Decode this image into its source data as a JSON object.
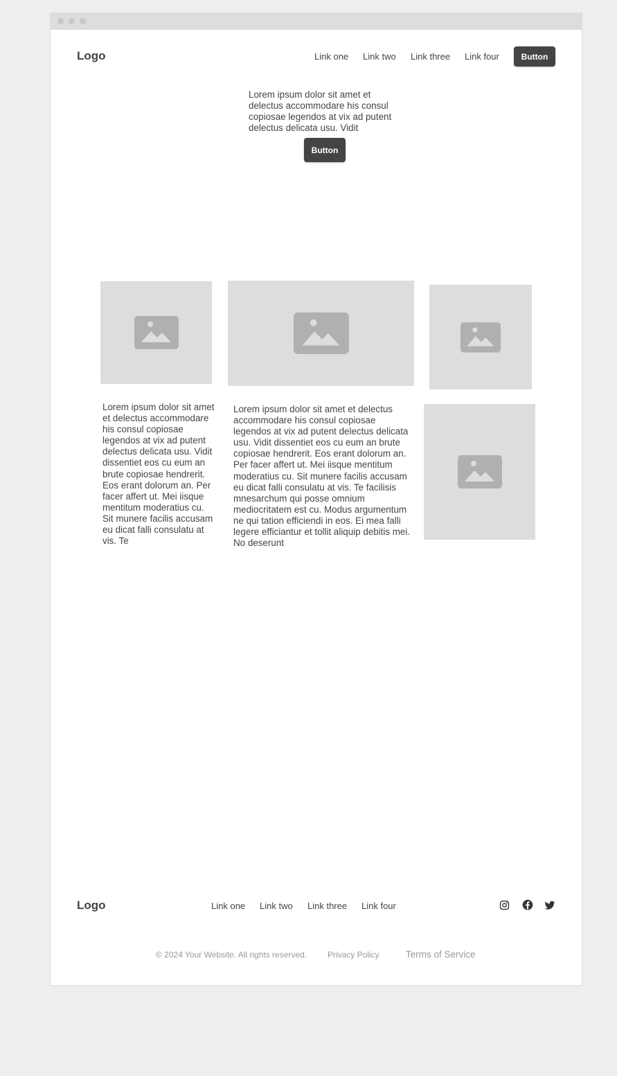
{
  "header": {
    "logo": "Logo",
    "links": [
      "Link one",
      "Link two",
      "Link three",
      "Link four"
    ],
    "button": "Button"
  },
  "hero": {
    "text": "Lorem ipsum dolor sit amet et delectus accommodare his consul copiosae legendos at vix ad putent delectus delicata usu. Vidit",
    "button": "Button"
  },
  "content": {
    "left_text": "Lorem ipsum dolor sit amet et delectus accommodare his consul copiosae legendos at vix ad putent delectus delicata usu. Vidit dissentiet eos cu eum an brute copiosae hendrerit. Eos erant dolorum an. Per facer affert ut. Mei iisque mentitum moderatius cu. Sit munere facilis accusam eu dicat falli consulatu at vis. Te",
    "middle_text": "Lorem ipsum dolor sit amet et delectus accommodare his consul copiosae legendos at vix ad putent delectus delicata usu. Vidit dissentiet eos cu eum an brute copiosae hendrerit. Eos erant dolorum an. Per facer affert ut. Mei iisque mentitum moderatius cu. Sit munere facilis accusam eu dicat falli consulatu at vis. Te facilisis mnesarchum qui posse omnium mediocritatem est cu. Modus argumentum ne qui tation efficiendi in eos. Ei mea falli legere efficiantur et tollit aliquip debitis mei. No deserunt"
  },
  "footer": {
    "logo": "Logo",
    "links": [
      "Link one",
      "Link two",
      "Link three",
      "Link four"
    ],
    "social_icons": [
      "instagram-icon",
      "facebook-icon",
      "twitter-icon"
    ],
    "copyright": "© 2024 Your Website. All rights reserved.",
    "privacy": "Privacy Policy",
    "terms": "Terms of Service"
  },
  "colors": {
    "page_background": "#eeeeee",
    "window_background": "#ffffff",
    "placeholder": "#dddddd",
    "placeholder_icon": "#b0b0b0",
    "button": "#444444",
    "text": "#444444",
    "muted_text": "#999999"
  }
}
